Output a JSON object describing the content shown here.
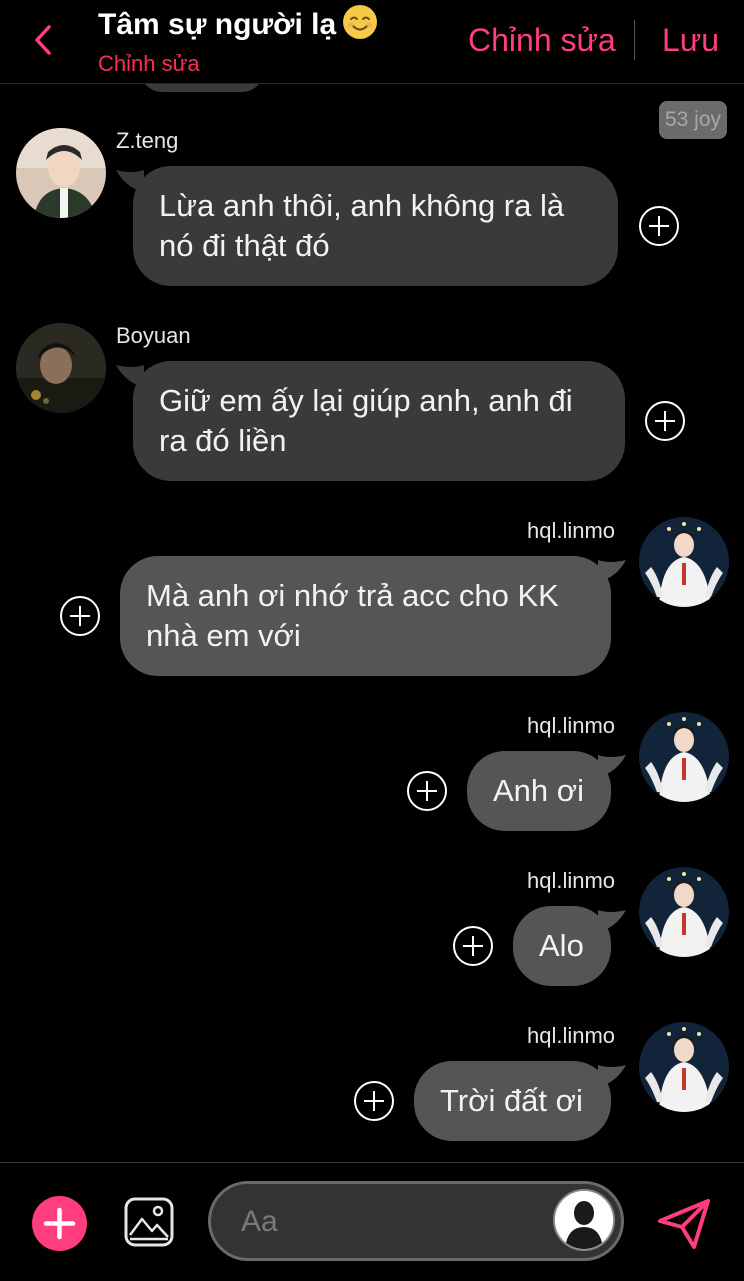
{
  "header": {
    "title": "Tâm sự người lạ",
    "subtitle": "Chỉnh sửa",
    "edit_label": "Chỉnh sửa",
    "save_label": "Lưu"
  },
  "joy_badge": "53 joy",
  "messages": [
    {
      "sender": "Z.teng",
      "text_line1": "Lừa anh thôi, anh không ra là",
      "text_line2": "nó đi thật đó"
    },
    {
      "sender": "Boyuan",
      "text_line1": "Giữ em ấy lại giúp anh, anh đi",
      "text_line2": "ra đó liền"
    },
    {
      "sender": "hql.linmo",
      "text_line1": "Mà anh ơi nhớ trả acc cho KK",
      "text_line2": "nhà em với"
    },
    {
      "sender": "hql.linmo",
      "text": "Anh ơi"
    },
    {
      "sender": "hql.linmo",
      "text": "Alo"
    },
    {
      "sender": "hql.linmo",
      "text": "Trời đất ơi"
    }
  ],
  "composer": {
    "placeholder": "Aa"
  },
  "colors": {
    "accent": "#ff3d7f",
    "subtitle": "#ff2c55",
    "bubble_other": "#3a3a3a",
    "bubble_mine": "#555555"
  }
}
